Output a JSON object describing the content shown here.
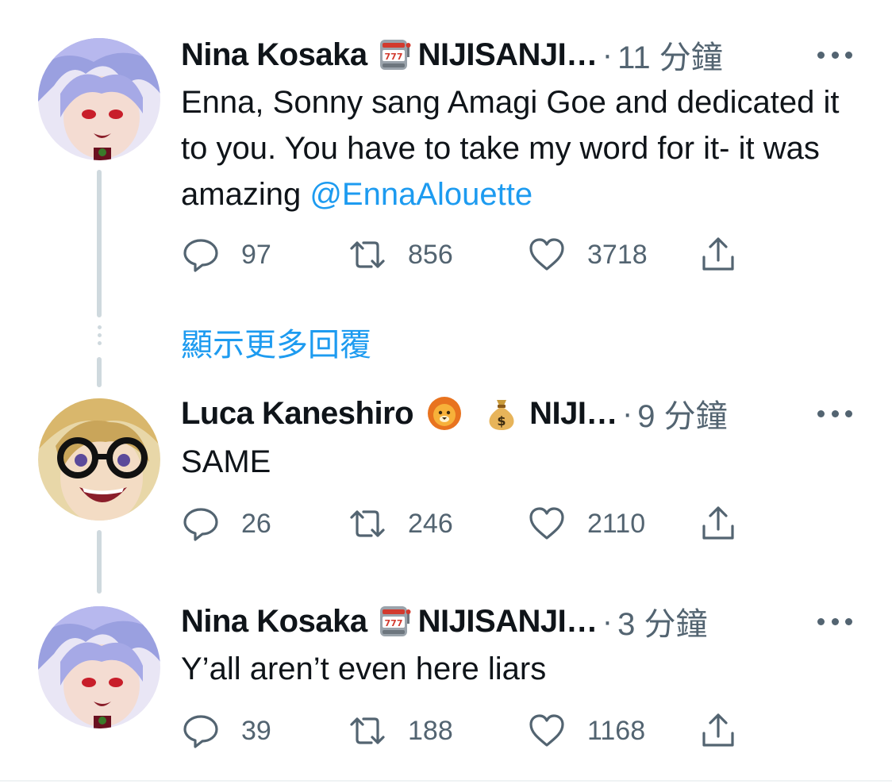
{
  "tweets": [
    {
      "author": "Nina Kosaka",
      "badge": "NIJISANJI…",
      "separator": "·",
      "time": "11 分鐘",
      "text": "Enna, Sonny sang Amagi Goe and dedicated it to you. You have to take my word for it- it was amazing ",
      "mention": "@EnnaAlouette",
      "replies": "97",
      "retweets": "856",
      "likes": "3718"
    },
    {
      "author": "Luca Kaneshiro",
      "badge": "NIJI…",
      "separator": "·",
      "time": "9 分鐘",
      "text": "SAME",
      "replies": "26",
      "retweets": "246",
      "likes": "2110"
    },
    {
      "author": "Nina Kosaka",
      "badge": "NIJISANJI…",
      "separator": "·",
      "time": "3 分鐘",
      "text": "Y’all aren’t even here  liars",
      "replies": "39",
      "retweets": "188",
      "likes": "1168"
    }
  ],
  "show_more_replies": "顯示更多回覆",
  "colors": {
    "accent": "#1d9bf0",
    "muted": "#536471",
    "thread_line": "#cfd9de"
  },
  "icons": [
    "reply-icon",
    "retweet-icon",
    "like-icon",
    "share-icon",
    "more-icon",
    "slot-machine-emoji",
    "lion-emoji",
    "money-bag-emoji"
  ]
}
